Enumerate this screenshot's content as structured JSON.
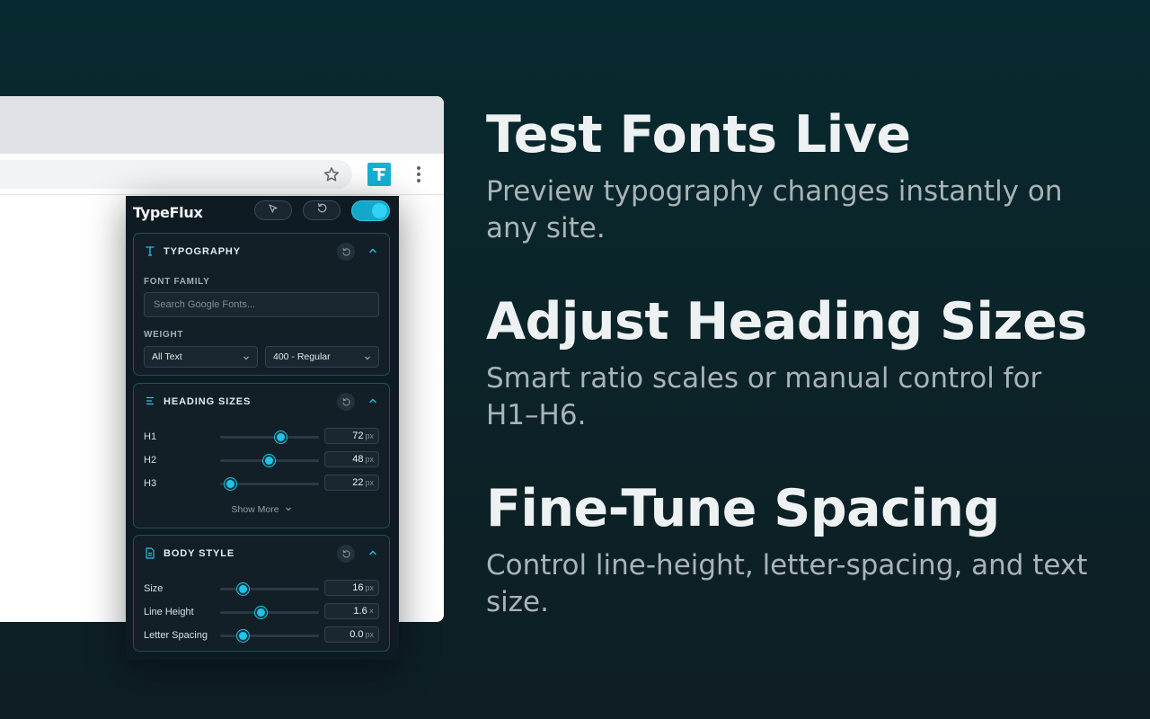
{
  "browser": {
    "extension_icon_letter": "F"
  },
  "panel": {
    "brand": "TypeFlux",
    "typography": {
      "title": "TYPOGRAPHY",
      "font_family_label": "FONT FAMILY",
      "search_placeholder": "Search Google Fonts...",
      "weight_label": "WEIGHT",
      "scope_value": "All Text",
      "weight_value": "400 - Regular"
    },
    "heading_sizes": {
      "title": "HEADING SIZES",
      "rows": [
        {
          "label": "H1",
          "value": "72",
          "unit": "px",
          "fraction": 0.61
        },
        {
          "label": "H2",
          "value": "48",
          "unit": "px",
          "fraction": 0.49
        },
        {
          "label": "H3",
          "value": "22",
          "unit": "px",
          "fraction": 0.1
        }
      ],
      "show_more": "Show More"
    },
    "body_style": {
      "title": "BODY STYLE",
      "rows": [
        {
          "label": "Size",
          "value": "16",
          "unit": "px",
          "fraction": 0.23
        },
        {
          "label": "Line Height",
          "value": "1.6",
          "unit": "×",
          "fraction": 0.41
        },
        {
          "label": "Letter Spacing",
          "value": "0.0",
          "unit": "px",
          "fraction": 0.23
        }
      ]
    }
  },
  "features": [
    {
      "title": "Test Fonts Live",
      "description": "Preview typography changes instantly on any site."
    },
    {
      "title": "Adjust Heading Sizes",
      "description": "Smart ratio scales or manual control for H1–H6."
    },
    {
      "title": "Fine-Tune Spacing",
      "description": "Control line-height, letter-spacing, and text size."
    }
  ],
  "colors": {
    "accent": "#22c3e6",
    "background": "#0b2429",
    "panel": "#0f1b22"
  }
}
